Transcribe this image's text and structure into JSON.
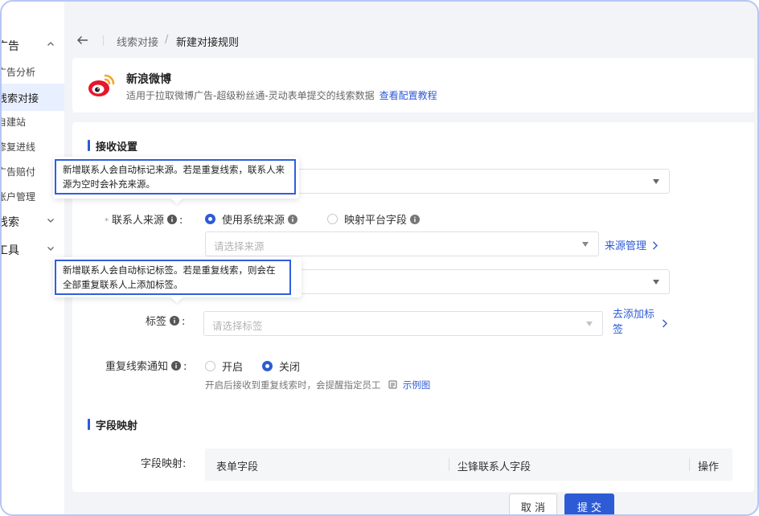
{
  "sidebar": {
    "items": [
      {
        "label": "广告",
        "type": "group"
      },
      {
        "label": "广告分析",
        "type": "sub"
      },
      {
        "label": "线索对接",
        "type": "sub",
        "active": true
      },
      {
        "label": "自建站",
        "type": "sub"
      },
      {
        "label": "修复进线",
        "type": "sub"
      },
      {
        "label": "广告赔付",
        "type": "sub"
      },
      {
        "label": "账户管理",
        "type": "sub"
      },
      {
        "label": "线索",
        "type": "group"
      },
      {
        "label": "工具",
        "type": "group"
      }
    ]
  },
  "breadcrumb": {
    "parent": "线索对接",
    "separator": "/",
    "current": "新建对接规则"
  },
  "header": {
    "title": "新浪微博",
    "description": "适用于拉取微博广告-超级粉丝通-灵动表单提交的线索数据",
    "link": "查看配置教程"
  },
  "section_receive": {
    "title": "接收设置"
  },
  "contact_source": {
    "label": "联系人来源",
    "required_mark": "*",
    "colon": ":",
    "option_system": "使用系统来源",
    "option_mapping": "映射平台字段",
    "select_placeholder": "请选择来源",
    "manage_link": "来源管理",
    "tooltip": "新增联系人会自动标记来源。若是重复线索，联系人来源为空时会补充来源。"
  },
  "tags": {
    "label": "标签",
    "colon": ":",
    "placeholder": "请选择标签",
    "add_link": "去添加标签",
    "tooltip": "新增联系人会自动标记标签。若是重复线索，则会在全部重复联系人上添加标签。"
  },
  "duplicate_notice": {
    "label": "重复线索通知",
    "colon": ":",
    "option_on": "开启",
    "option_off": "关闭",
    "hint": "开启后接收到重复线索时，会提醒指定员工",
    "example_link": "示例图"
  },
  "section_mapping": {
    "title": "字段映射"
  },
  "mapping": {
    "label": "字段映射:",
    "columns": [
      "表单字段",
      "尘锋联系人字段",
      "操作"
    ]
  },
  "footer": {
    "cancel": "取 消",
    "submit": "提 交"
  },
  "colors": {
    "accent": "#2d5bd6",
    "weibo_red": "#e6162d",
    "weibo_orange": "#f5a623"
  }
}
